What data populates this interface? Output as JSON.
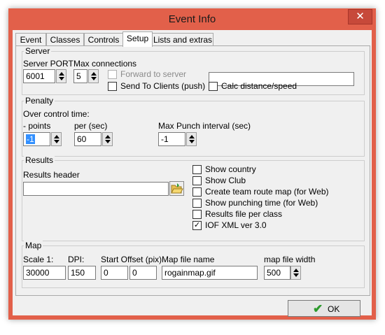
{
  "window": {
    "title": "Event Info",
    "close_glyph": "✕"
  },
  "tabs": [
    {
      "label": "Event"
    },
    {
      "label": "Classes"
    },
    {
      "label": "Controls"
    },
    {
      "label": "Setup"
    },
    {
      "label": "Lists and extras"
    }
  ],
  "active_tab": "Setup",
  "server": {
    "group_label": "Server",
    "port_label": "Server PORT",
    "port_value": "6001",
    "maxconn_label": "Max connections",
    "maxconn_value": "5",
    "forward_label": "Forward to server",
    "forward_checked": false,
    "forward_enabled": false,
    "send_label": "Send To Clients (push)",
    "send_checked": false,
    "forward_address_value": "",
    "calc_label": "Calc distance/speed",
    "calc_checked": false
  },
  "penalty": {
    "group_label": "Penalty",
    "over_label": "Over control time:",
    "points_label": "- points",
    "points_value": "-1",
    "per_label": "per (sec)",
    "per_value": "60",
    "maxpunch_label": "Max Punch interval (sec)",
    "maxpunch_value": "-1"
  },
  "results": {
    "group_label": "Results",
    "header_label": "Results header",
    "header_value": "",
    "options": [
      {
        "label": "Show country",
        "checked": false
      },
      {
        "label": "Show Club",
        "checked": false
      },
      {
        "label": "Create team route map (for Web)",
        "checked": false
      },
      {
        "label": "Show punching time  (for Web)",
        "checked": false
      },
      {
        "label": "Results file per class",
        "checked": false
      },
      {
        "label": "IOF XML ver 3.0",
        "checked": true
      }
    ]
  },
  "map": {
    "group_label": "Map",
    "scale_label": "Scale 1:",
    "scale_value": "30000",
    "dpi_label": "DPI:",
    "dpi_value": "150",
    "offset_label": "Start Offset (pix)",
    "offset_x_value": "0",
    "offset_y_value": "0",
    "file_label": "Map file name",
    "file_value": "rogainmap.gif",
    "width_label": "map file width",
    "width_value": "500"
  },
  "buttons": {
    "ok_label": "OK",
    "ok_icon": "checkmark-icon"
  },
  "colors": {
    "window_frame": "#e2604a",
    "dialog_bg": "#f0f0f0",
    "close_button": "#c7493a",
    "ok_check": "#2c9a2c"
  }
}
